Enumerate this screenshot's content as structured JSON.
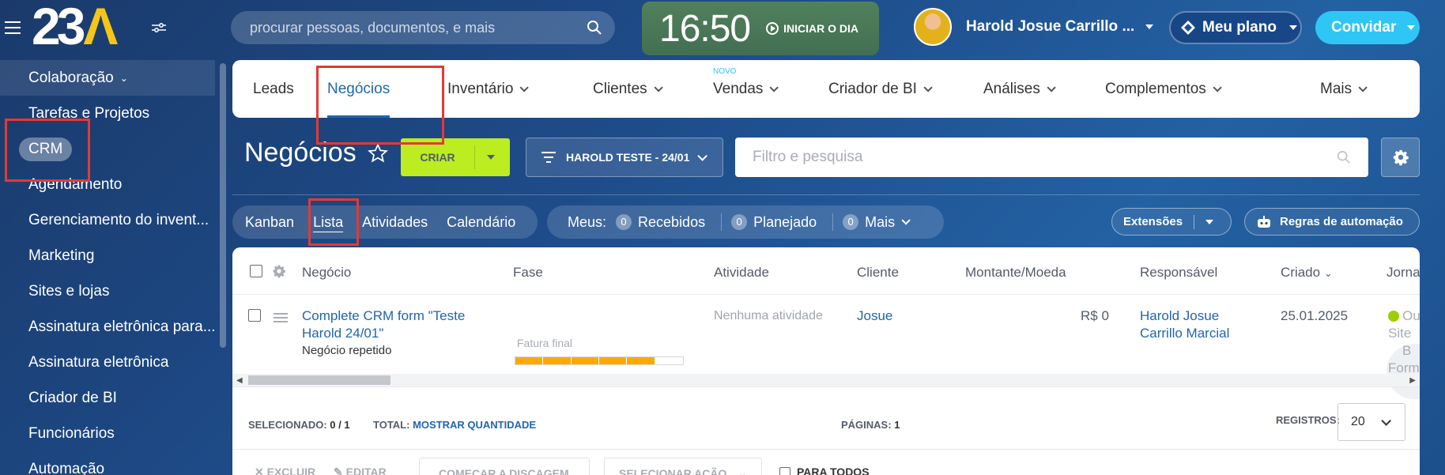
{
  "app": {
    "logo_text": "23",
    "logo_accent": "Λ",
    "accent_color": "#f5c518"
  },
  "search": {
    "placeholder": "procurar pessoas, documentos, e mais"
  },
  "clock": {
    "time": "16:50",
    "start_label": "INICIAR O DIA"
  },
  "user": {
    "name": "Harold Josue Carrillo ..."
  },
  "plan": {
    "label": "Meu plano"
  },
  "invite": {
    "label": "Convidar"
  },
  "sidebar": {
    "items": [
      {
        "label": "Colaboração"
      },
      {
        "label": "Tarefas e Projetos"
      },
      {
        "label": "CRM"
      },
      {
        "label": "Agendamento"
      },
      {
        "label": "Gerenciamento do invent..."
      },
      {
        "label": "Marketing"
      },
      {
        "label": "Sites e lojas"
      },
      {
        "label": "Assinatura eletrônica para..."
      },
      {
        "label": "Assinatura eletrônica"
      },
      {
        "label": "Criador de BI"
      },
      {
        "label": "Funcionários"
      },
      {
        "label": "Automação"
      }
    ]
  },
  "nav": {
    "items": [
      {
        "label": "Leads"
      },
      {
        "label": "Negócios"
      },
      {
        "label": "Inventário"
      },
      {
        "label": "Clientes"
      },
      {
        "label": "Vendas",
        "badge": "NOVO"
      },
      {
        "label": "Criador de BI"
      },
      {
        "label": "Análises"
      },
      {
        "label": "Complementos"
      },
      {
        "label": "Mais"
      }
    ]
  },
  "page": {
    "title": "Negócios",
    "create_label": "CRIAR",
    "filter_label": "HAROLD TESTE - 24/01",
    "filter_placeholder": "Filtro e pesquisa"
  },
  "views": {
    "items": [
      {
        "label": "Kanban"
      },
      {
        "label": "Lista"
      },
      {
        "label": "Atividades"
      },
      {
        "label": "Calendário"
      }
    ]
  },
  "meus": {
    "label": "Meus:",
    "counters": [
      {
        "count": "0",
        "label": "Recebidos"
      },
      {
        "count": "0",
        "label": "Planejado"
      },
      {
        "count": "0",
        "label": "Mais"
      }
    ]
  },
  "extensions": {
    "label": "Extensões"
  },
  "automation": {
    "label": "Regras de automação"
  },
  "table": {
    "columns": [
      "Negócio",
      "Fase",
      "Atividade",
      "Cliente",
      "Montante/Moeda",
      "Responsável",
      "Criado",
      "Jorna"
    ],
    "rows": [
      {
        "deal_line1": "Complete CRM form \"Teste",
        "deal_line2": "Harold 24/01\"",
        "deal_sub": "Negócio repetido",
        "stage": "Fatura final",
        "stage_progress": 0.83,
        "activity": "Nenhuma atividade",
        "client": "Josue",
        "amount": "R$ 0",
        "responsible_line1": "Harold Josue",
        "responsible_line2": "Carrillo Marcial",
        "created": "25.01.2025",
        "journal_line1": "Ou",
        "journal_line2": "Site B",
        "journal_line3": "Form"
      }
    ]
  },
  "footer": {
    "selected_label": "SELECIONADO:",
    "selected_value": "0 / 1",
    "total_label": "TOTAL:",
    "total_value": "MOSTRAR QUANTIDADE",
    "pages_label": "PÁGINAS:",
    "pages_value": "1",
    "records_label": "REGISTROS:",
    "records_value": "20"
  },
  "actions": {
    "delete": "EXCLUIR",
    "edit": "EDITAR",
    "dial": "COMEÇAR A DISCAGEM",
    "select_action": "SELECIONAR AÇÃO",
    "for_all": "PARA TODOS"
  }
}
